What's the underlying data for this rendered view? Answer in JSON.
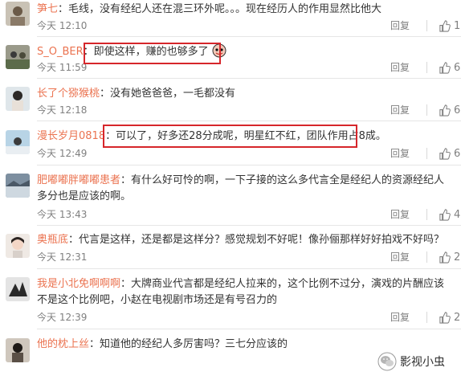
{
  "comments": [
    {
      "user": "笋七",
      "text": "毛线，没有经纪人还在混三环外呢。。。现在经历人的作用显然比他大",
      "time": "今天 12:10",
      "reply_label": "回复",
      "likes": "11"
    },
    {
      "user": "S_O_BER",
      "text": "即使这样，赚的也够多了",
      "time": "今天 11:59",
      "reply_label": "回复",
      "likes": "6"
    },
    {
      "user": "长了个猕猴桃",
      "text": "没有她爸爸爸，一毛都没有",
      "time": "今天 12:18",
      "reply_label": "回复",
      "likes": "6"
    },
    {
      "user": "漫长岁月0818",
      "text": "可以了，好多还28分成呢，明星红不红，团队作用占8成。",
      "time": "今天 12:49",
      "reply_label": "回复",
      "likes": "6"
    },
    {
      "user": "肥嘟嘟胖嘟嘟患者",
      "text": "有什么好可怜的啊，一下子接的这么多代言全是经纪人的资源经纪人多分也是应该的啊。",
      "time": "今天 13:43",
      "reply_label": "回复",
      "likes": "4"
    },
    {
      "user": "奥瓶底",
      "text": "代言是这样，还是都是这样分？感觉规划不好呢！像孙俪那样好好拍戏不好吗？",
      "time": "今天 12:31",
      "reply_label": "回复",
      "likes": "2"
    },
    {
      "user": "我是小北免啊啊啊",
      "text": "大牌商业代言都是经纪人拉来的，这个比例不过分，演戏的片酬应该不是这个比例吧，小赵在电视剧市场还是有号召力的",
      "time": "今天 12:39",
      "reply_label": "回复",
      "likes": "2"
    },
    {
      "user": "他的枕上丝",
      "text": "知道他的经纪人多厉害吗？三七分应该的",
      "time": "",
      "reply_label": "",
      "likes": ""
    }
  ],
  "watermark": {
    "text": "影视小虫"
  },
  "colors": {
    "username": "#eb7350",
    "highlight": "#d6262b",
    "meta": "#808080"
  },
  "icons": {
    "like": "thumbs-up-icon",
    "emoji": "emoji-icon",
    "watermark_logo": "wechat-logo-icon"
  }
}
